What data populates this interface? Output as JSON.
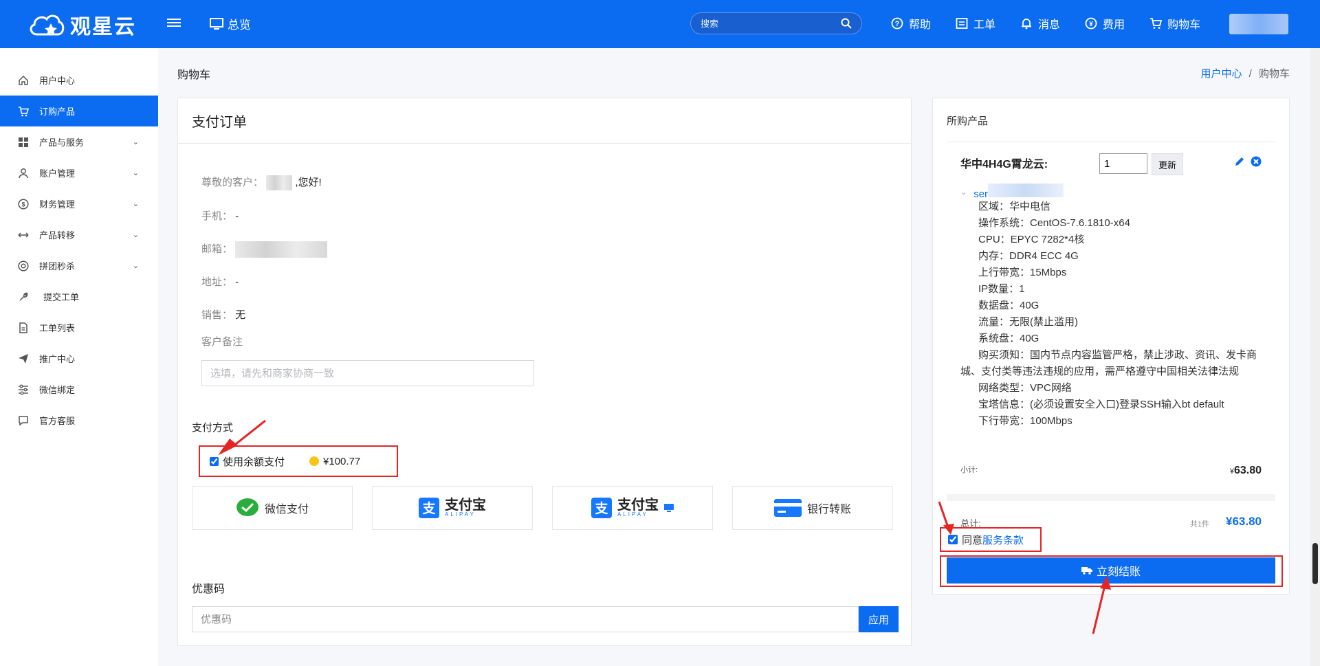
{
  "header": {
    "logo_text": "观星云",
    "overview_label": "总览",
    "search_placeholder": "搜索",
    "nav": [
      {
        "icon": "help-icon",
        "label": "帮助"
      },
      {
        "icon": "ticket-icon",
        "label": "工单"
      },
      {
        "icon": "bell-icon",
        "label": "消息"
      },
      {
        "icon": "yen-icon",
        "label": "费用"
      },
      {
        "icon": "cart-icon",
        "label": "购物车"
      }
    ]
  },
  "sidebar": {
    "items": [
      {
        "label": "用户中心",
        "icon": "home-icon",
        "active": false,
        "expandable": false
      },
      {
        "label": "订购产品",
        "icon": "cart-icon",
        "active": true,
        "expandable": false
      },
      {
        "label": "产品与服务",
        "icon": "grid-icon",
        "active": false,
        "expandable": true
      },
      {
        "label": "账户管理",
        "icon": "user-icon",
        "active": false,
        "expandable": true
      },
      {
        "label": "财务管理",
        "icon": "yen-icon",
        "active": false,
        "expandable": true
      },
      {
        "label": "产品转移",
        "icon": "transfer-icon",
        "active": false,
        "expandable": true
      },
      {
        "label": "拼团秒杀",
        "icon": "camera-icon",
        "active": false,
        "expandable": true
      },
      {
        "label": "提交工单",
        "icon": "wrench-icon",
        "active": false,
        "expandable": false
      },
      {
        "label": "工单列表",
        "icon": "document-icon",
        "active": false,
        "expandable": false
      },
      {
        "label": "推广中心",
        "icon": "send-icon",
        "active": false,
        "expandable": false
      },
      {
        "label": "微信绑定",
        "icon": "sliders-icon",
        "active": false,
        "expandable": false
      },
      {
        "label": "官方客服",
        "icon": "chat-icon",
        "active": false,
        "expandable": false
      }
    ]
  },
  "page": {
    "title": "购物车",
    "breadcrumb": {
      "parent": "用户中心",
      "separator": "/",
      "current": "购物车"
    }
  },
  "order": {
    "title": "支付订单",
    "greeting_label": "尊敬的客户：",
    "greeting_suffix": ",您好!",
    "phone_label": "手机：",
    "phone_value": "-",
    "email_label": "邮箱：",
    "address_label": "地址：",
    "address_value": "-",
    "sales_label": "销售：",
    "sales_value": "无",
    "remark_label": "客户备注",
    "remark_placeholder": "选填，请先和商家协商一致",
    "payment_label": "支付方式",
    "balance_label": "使用余额支付",
    "balance_amount": "¥100.77",
    "balance_checked": true,
    "payment_options": [
      {
        "icon": "wechat-pay-icon",
        "label": "微信支付"
      },
      {
        "icon": "alipay-icon",
        "label": "支付宝",
        "sub": "ALIPAY"
      },
      {
        "icon": "alipay-qr-icon",
        "label": "支付宝",
        "sub": "ALIPAY"
      },
      {
        "icon": "bank-card-icon",
        "label": "银行转账"
      }
    ],
    "coupon_label": "优惠码",
    "coupon_placeholder": "优惠码",
    "coupon_apply": "应用"
  },
  "cart": {
    "title": "所购产品",
    "product_name": "华中4H4G霄龙云:",
    "quantity": "1",
    "update_label": "更新",
    "server_prefix": "ser",
    "specs": [
      "区域：华中电信",
      "操作系统：CentOS-7.6.1810-x64",
      "CPU：EPYC 7282*4核",
      "内存：DDR4 ECC 4G",
      "上行带宽：15Mbps",
      "IP数量：1",
      "数据盘：40G",
      "流量：无限(禁止滥用)",
      "系统盘：40G",
      "购买须知：国内节点内容监管严格，禁止涉政、资讯、发卡商城、支付类等违法违规的应用，需严格遵守中国相关法律法规",
      "网络类型：VPC网络",
      "宝塔信息：(必须设置安全入口)登录SSH输入bt default",
      "下行带宽：100Mbps"
    ],
    "subtotal_label": "小计:",
    "subtotal_currency": "¥",
    "subtotal_value": "63.80",
    "total_label": "总计:",
    "total_count": "共1件",
    "total_value": "¥63.80",
    "agree_prefix": "同意",
    "agree_link": "服务条款",
    "agree_checked": true,
    "checkout_label": "立刻结账"
  },
  "colors": {
    "brand": "#0b6cf2",
    "highlight": "#e52424"
  }
}
